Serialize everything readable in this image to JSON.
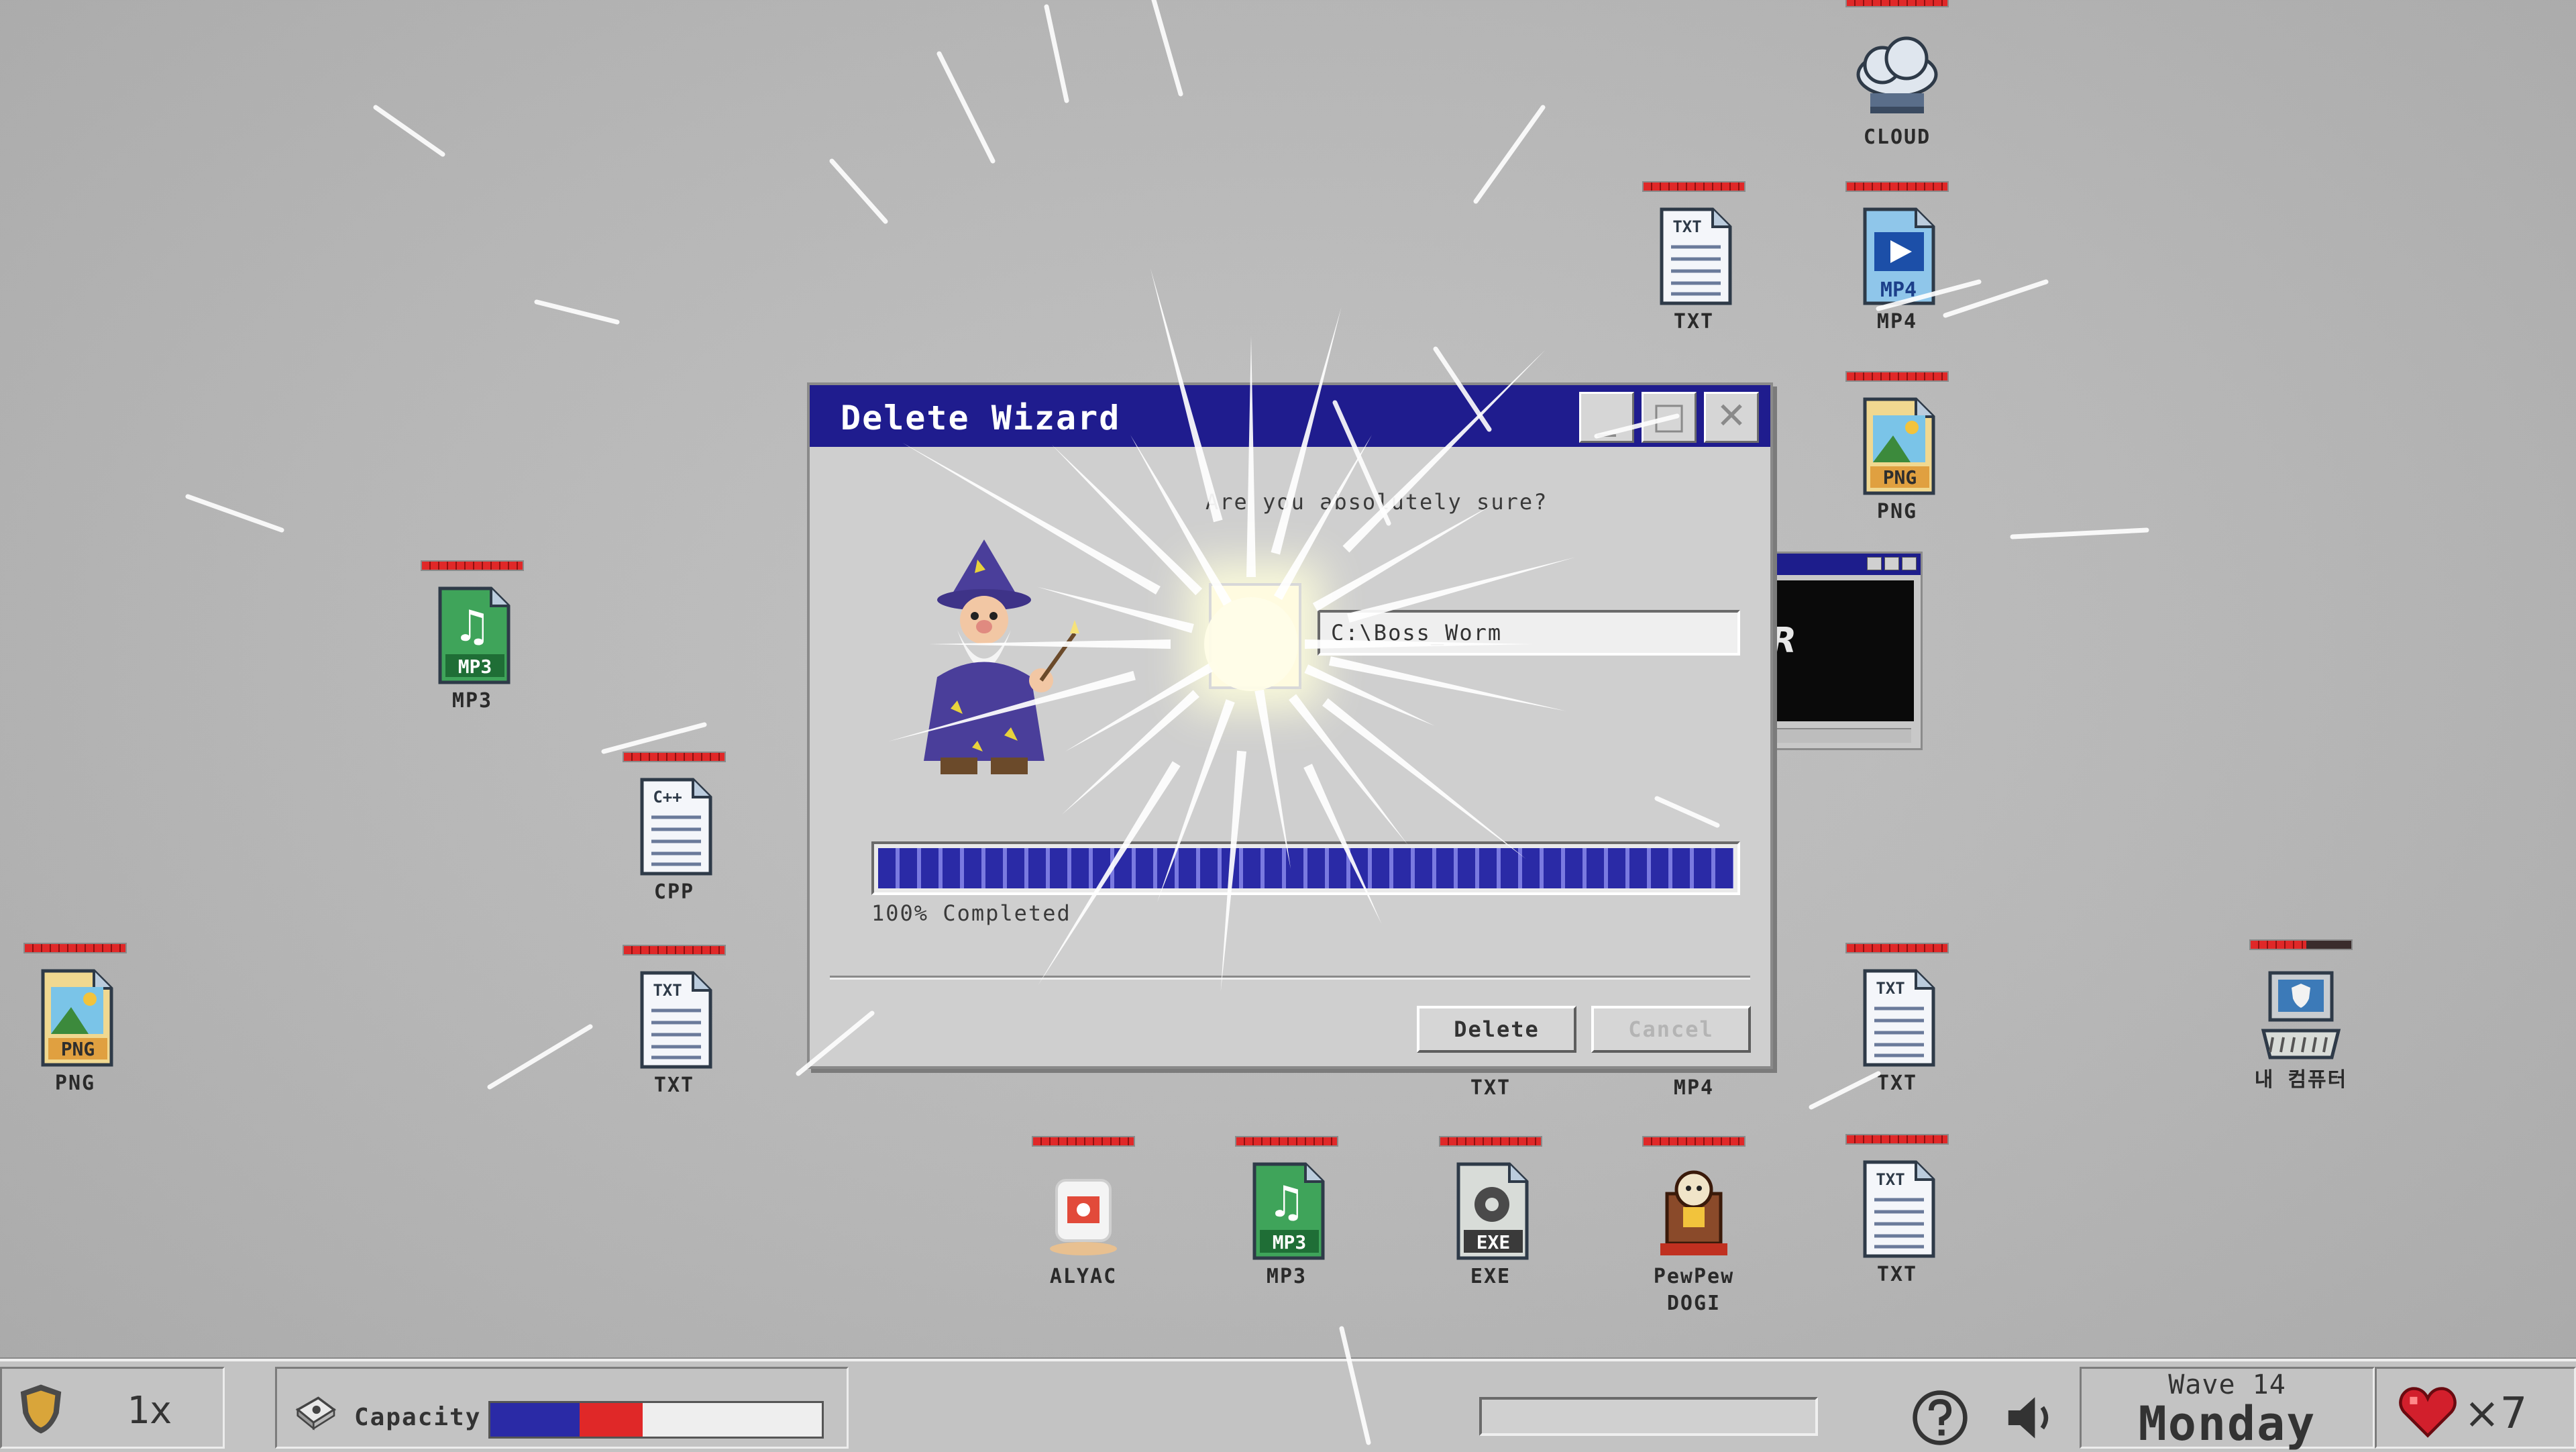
{
  "dialog": {
    "title": "Delete Wizard",
    "question": "Are you absolutely sure?",
    "path": "C:\\Boss_Worm",
    "progress_pct": 100,
    "progress_label": "100% Completed",
    "delete_label": "Delete",
    "cancel_label": "Cancel",
    "minimize_glyph": "_",
    "maximize_glyph": "□",
    "close_glyph": "✕"
  },
  "desktop_icons": [
    {
      "label": "CLOUD",
      "type": "cloud",
      "hp": 1.0
    },
    {
      "label": "TXT",
      "type": "txt",
      "hp": 1.0
    },
    {
      "label": "MP4",
      "type": "mp4",
      "hp": 1.0
    },
    {
      "label": "PNG",
      "type": "png",
      "hp": 1.0
    },
    {
      "label": "MP3",
      "type": "mp3",
      "hp": 1.0
    },
    {
      "label": "CPP",
      "type": "cpp",
      "hp": 1.0
    },
    {
      "label": "PNG",
      "type": "png",
      "hp": 1.0
    },
    {
      "label": "TXT",
      "type": "txt",
      "hp": 1.0
    },
    {
      "label": "TXT",
      "type": "txt",
      "hp": 1.0
    },
    {
      "label": "MP4",
      "type": "mp4",
      "hp": 1.0
    },
    {
      "label": "TXT",
      "type": "txt",
      "hp": 1.0
    },
    {
      "label": "내 컴퓨터",
      "type": "computer",
      "hp": 0.55
    },
    {
      "label": "ALYAC",
      "type": "alyac",
      "hp": 1.0
    },
    {
      "label": "MP3",
      "type": "mp3",
      "hp": 1.0
    },
    {
      "label": "EXE",
      "type": "exe",
      "hp": 1.0
    },
    {
      "label": "PewPew DOGI",
      "type": "dogi",
      "hp": 1.0
    },
    {
      "label": "TXT",
      "type": "txt",
      "hp": 1.0
    }
  ],
  "taskbar": {
    "speed": "1x",
    "capacity_label": "Capacity",
    "capacity_blue": 0.27,
    "capacity_red": 0.19,
    "wave_progress": 0,
    "wave": "Wave 14",
    "day": "Monday",
    "lives": "×7"
  },
  "colors": {
    "titlebar": "#1f1c8e",
    "progress": "#2a2aa6",
    "hp": "#e02828"
  },
  "icons": [
    "shield-icon",
    "disk-icon",
    "help-icon",
    "speaker-icon",
    "heart-icon",
    "wizard-icon",
    "mini-window-icon"
  ]
}
